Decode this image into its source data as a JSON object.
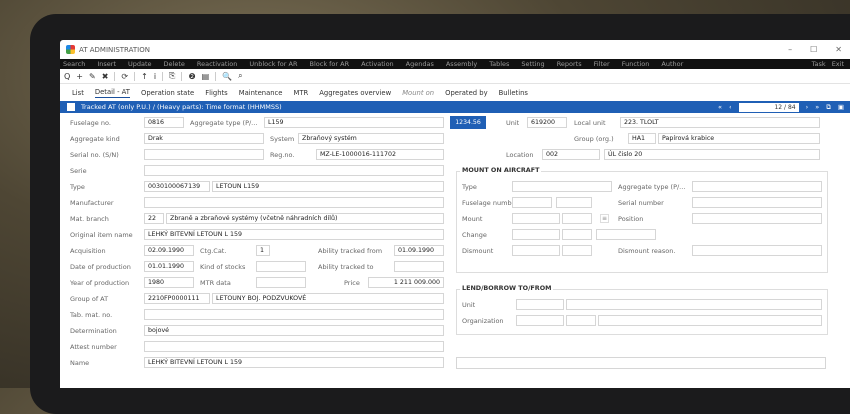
{
  "window": {
    "title": "AT ADMINISTRATION",
    "controls": [
      "–",
      "☐",
      "✕"
    ]
  },
  "menu": {
    "items": [
      "Search",
      "Insert",
      "Update",
      "Delete",
      "Reactivation",
      "Unblock for AR",
      "Block for AR",
      "Activation",
      "Agendas",
      "Assembly",
      "Tables",
      "Setting",
      "Reports",
      "Filter",
      "Function",
      "Author"
    ],
    "right": [
      "Task",
      "Exit"
    ]
  },
  "toolbar": {
    "icons": [
      "search-icon",
      "add-icon",
      "edit-icon",
      "delete-icon",
      "refresh-icon",
      "pin-icon",
      "info-icon",
      "copy-icon",
      "help-icon",
      "print-icon",
      "zoom-icon",
      "zoom-out-icon"
    ],
    "glyphs": [
      "Q",
      "+",
      "✎",
      "✖",
      "⟳",
      "↑",
      "i",
      "⎘",
      "❷",
      "▤",
      "🔍",
      "⌕"
    ]
  },
  "tabs": [
    "List",
    "Detail - AT",
    "Operation state",
    "Flights",
    "Maintenance",
    "MTR",
    "Aggregates overview",
    "Mount on",
    "Operated by",
    "Bulletins"
  ],
  "band": {
    "label": "Tracked AT (only P.U.) / (Heavy parts): Time format (HHMMSS)",
    "page": "12 / 84"
  },
  "left": {
    "fusealage_label": "Fuselage no.",
    "fusealage_value": "0816",
    "aggtype_label": "Aggregate type (P/...",
    "aggtype_value": "L159",
    "aggkind_label": "Aggregate kind",
    "aggkind_value": "Drak",
    "system_label": "System",
    "system_value": "Zbraňový systém",
    "serial_label": "Serial no. (S/N)",
    "regno_label": "Reg.no.",
    "regno_value": "MZ-LE-1000016-111702",
    "serie_label": "Serie",
    "type_label": "Type",
    "type_code": "0030100067139",
    "type_value": "LETOUN L159",
    "manuf_label": "Manufacturer",
    "matbranch_label": "Mat. branch",
    "matbranch_code": "22",
    "matbranch_value": "Zbraně a zbraňové systémy (včetně náhradních dílů)",
    "origname_label": "Original item name",
    "origname_value": "LEHKÝ BITEVNÍ LETOUN L 159",
    "acq_label": "Acquisition",
    "acq_value": "02.09.1990",
    "ctg_label": "Ctg.Cat.",
    "ctg_value": "1",
    "abfrom_label": "Ability tracked from",
    "abfrom_value": "01.09.1990",
    "dop_label": "Date of production",
    "dop_value": "01.01.1990",
    "kos_label": "Kind of stocks",
    "abto_label": "Ability tracked to",
    "yop_label": "Year of production",
    "yop_value": "1980",
    "mtr_label": "MTR data",
    "price_label": "Price",
    "price_value": "1 211 009.000",
    "group_label": "Group of AT",
    "group_code": "2210FP0000111",
    "group_value": "LETOUNY BOJ. PODZVUKOVÉ",
    "tab_label": "Tab. mat. no.",
    "det_label": "Determination",
    "det_value": "bojové",
    "attest_label": "Attest number",
    "name_label": "Name",
    "name_value": "LEHKÝ BITEVNÍ LETOUN L 159"
  },
  "right": {
    "badge": "1234.56",
    "unit_label": "Unit",
    "unit_value": "619200",
    "localunit_label": "Local unit",
    "localunit_value": "223. TLOLT",
    "grouporg_label": "Group (org.)",
    "grouporg_code": "HA1",
    "grouporg_value": "Papírová krabice",
    "location_label": "Location",
    "location_code": "002",
    "location_value": "ÚL čislo 20",
    "mount": {
      "title": "MOUNT ON AIRCRAFT",
      "type": "Type",
      "aggtype": "Aggregate type (P/...",
      "fusnum": "Fuselage number",
      "serial": "Serial number",
      "mount": "Mount",
      "position": "Position",
      "change": "Change",
      "dismount": "Dismount",
      "dismountreason": "Dismount reason."
    },
    "lend": {
      "title": "LEND/BORROW TO/FROM",
      "unit": "Unit",
      "org": "Organization"
    }
  }
}
